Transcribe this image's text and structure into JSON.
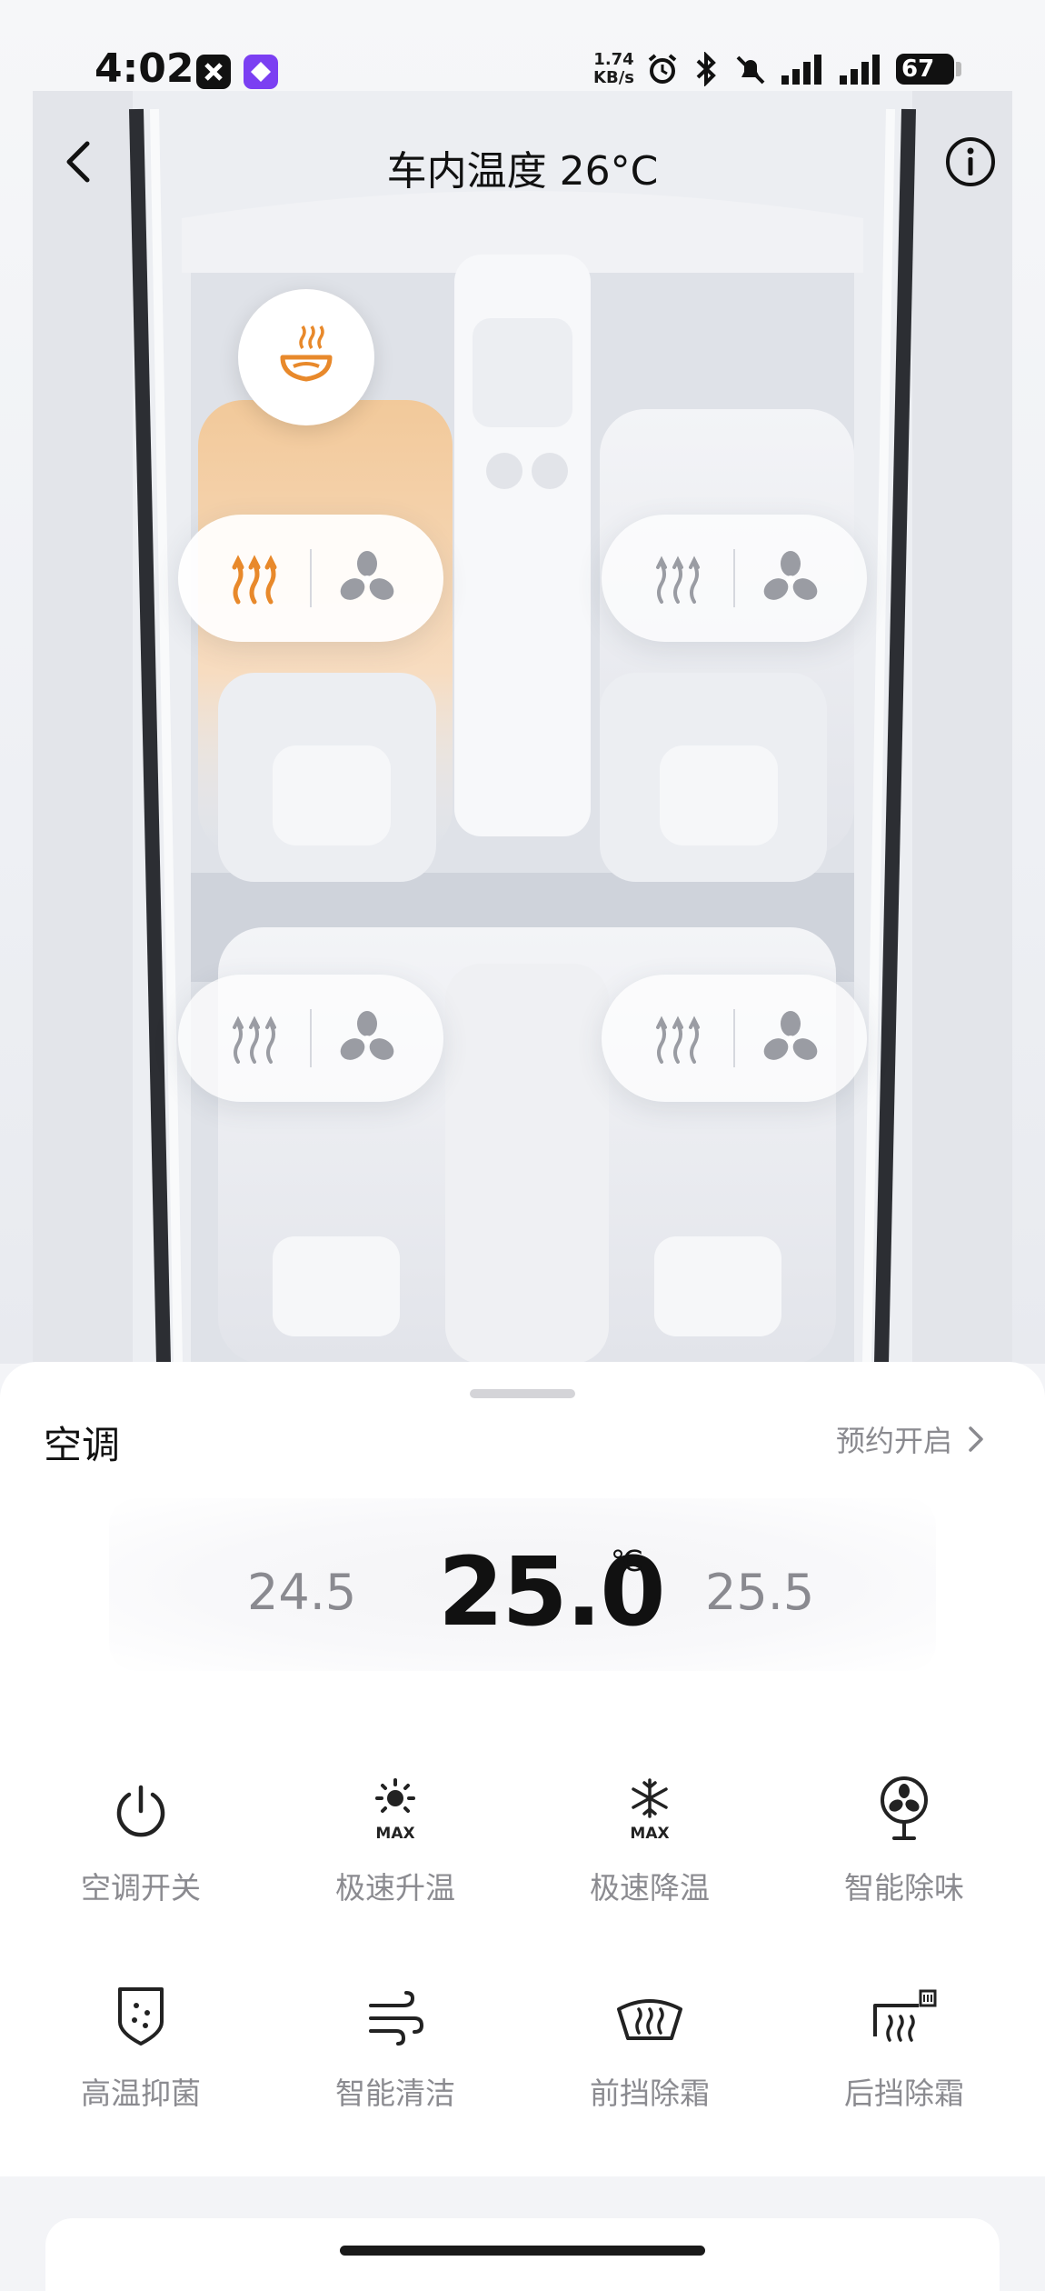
{
  "status_bar": {
    "time": "4:02",
    "net_speed_value": "1.74",
    "net_speed_unit": "KB/s",
    "battery": "67",
    "icons": [
      "app-x-icon",
      "app-diamond-icon",
      "alarm-icon",
      "bluetooth-icon",
      "mute-icon",
      "signal-icon",
      "signal-icon",
      "battery-icon"
    ]
  },
  "header": {
    "title": "车内温度 26°C",
    "back_icon": "chevron-left-icon",
    "info_icon": "info-icon"
  },
  "seats": {
    "front_left": {
      "heat_active": true,
      "fan_active": false
    },
    "front_right": {
      "heat_active": false,
      "fan_active": false
    },
    "rear_left": {
      "heat_active": false,
      "fan_active": false
    },
    "rear_right": {
      "heat_active": false,
      "fan_active": false
    },
    "steering_heat_active": true
  },
  "colors": {
    "active": "#E8892B",
    "inactive": "#9A9CA3",
    "text_main": "#111111",
    "text_secondary": "#8A8A8F"
  },
  "panel": {
    "title": "空调",
    "schedule_label": "预约开启",
    "temp_lower": "24.5",
    "temp_current": "25.0",
    "temp_unit": "℃",
    "temp_higher": "25.5",
    "controls": [
      {
        "label": "空调开关",
        "icon": "power-icon"
      },
      {
        "label": "极速升温",
        "icon": "sun-max-icon"
      },
      {
        "label": "极速降温",
        "icon": "snowflake-max-icon"
      },
      {
        "label": "智能除味",
        "icon": "fan-deodorize-icon"
      },
      {
        "label": "高温抑菌",
        "icon": "shield-bacteria-icon"
      },
      {
        "label": "智能清洁",
        "icon": "wind-clean-icon"
      },
      {
        "label": "前挡除霜",
        "icon": "front-defrost-icon"
      },
      {
        "label": "后挡除霜",
        "icon": "rear-defrost-icon"
      }
    ]
  }
}
